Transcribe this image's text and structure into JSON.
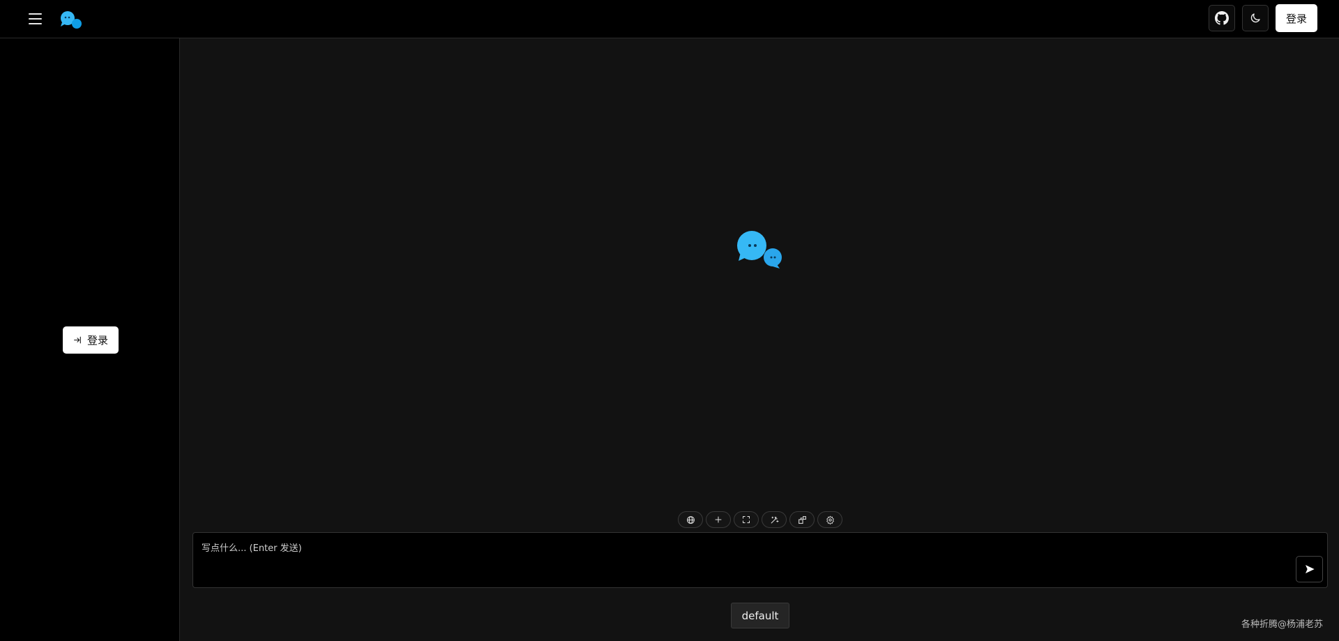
{
  "header": {
    "menu_icon": "hamburger-menu-icon",
    "logo_icon": "chat-bubbles-logo",
    "github_icon": "github-icon",
    "theme_icon": "moon-icon",
    "login_label": "登录"
  },
  "sidebar": {
    "login_icon": "login-arrow-icon",
    "login_label": "登录"
  },
  "main": {
    "center_logo_icon": "chat-bubbles-logo",
    "toolbar": [
      {
        "icon": "globe-icon"
      },
      {
        "icon": "plus-icon"
      },
      {
        "icon": "fullscreen-icon"
      },
      {
        "icon": "magic-wand-icon"
      },
      {
        "icon": "plugins-icon"
      },
      {
        "icon": "gear-icon"
      }
    ],
    "input": {
      "value": "",
      "placeholder": "写点什么... (Enter 发送)"
    },
    "send_icon": "send-arrow-icon",
    "model_label": "default",
    "footer_credit": "各种折腾@杨浦老苏"
  },
  "colors": {
    "background": "#121212",
    "header_bg": "#000000",
    "logo_blue": "#2eb5f5",
    "button_light": "#ffffff"
  }
}
